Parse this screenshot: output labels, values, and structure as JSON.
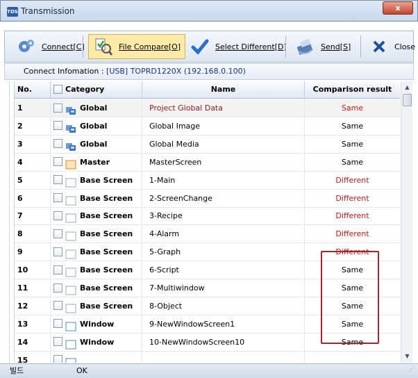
{
  "window": {
    "title": "Transmission",
    "app_icon_text": "TDS",
    "close_symbol": "x"
  },
  "toolbar": [
    {
      "label": "Connect",
      "key": "C"
    },
    {
      "label": "File Compare",
      "key": "O"
    },
    {
      "label": "Select Different",
      "key": "D"
    },
    {
      "label": "Send",
      "key": "S"
    },
    {
      "label": "Close"
    }
  ],
  "connect": {
    "label": "Connect Infomation :",
    "value": "[USB] TOPRD1220X (192.168.0.100)"
  },
  "columns": {
    "no": "No.",
    "category": "Category",
    "name": "Name",
    "result": "Comparison result"
  },
  "rows": [
    {
      "no": "1",
      "category": "Global",
      "icon": "global",
      "name": "Project Global Data",
      "result": "Same",
      "name_color": "#a01818"
    },
    {
      "no": "2",
      "category": "Global",
      "icon": "global",
      "name": "Global Image",
      "result": "Same"
    },
    {
      "no": "3",
      "category": "Global",
      "icon": "global",
      "name": "Global Media",
      "result": "Same"
    },
    {
      "no": "4",
      "category": "Master",
      "icon": "master",
      "name": "MasterScreen",
      "result": "Same"
    },
    {
      "no": "5",
      "category": "Base Screen",
      "icon": "screen",
      "name": "1-Main",
      "result": "Different"
    },
    {
      "no": "6",
      "category": "Base Screen",
      "icon": "screen",
      "name": "2-ScreenChange",
      "result": "Different"
    },
    {
      "no": "7",
      "category": "Base Screen",
      "icon": "screen",
      "name": "3-Recipe",
      "result": "Different"
    },
    {
      "no": "8",
      "category": "Base Screen",
      "icon": "screen",
      "name": "4-Alarm",
      "result": "Different"
    },
    {
      "no": "9",
      "category": "Base Screen",
      "icon": "screen",
      "name": "5-Graph",
      "result": "Different"
    },
    {
      "no": "10",
      "category": "Base Screen",
      "icon": "screen",
      "name": "6-Script",
      "result": "Same"
    },
    {
      "no": "11",
      "category": "Base Screen",
      "icon": "screen",
      "name": "7-Multiwindow",
      "result": "Same"
    },
    {
      "no": "12",
      "category": "Base Screen",
      "icon": "screen",
      "name": "8-Object",
      "result": "Same"
    },
    {
      "no": "13",
      "category": "Window",
      "icon": "window",
      "name": "9-NewWindowScreen1",
      "result": "Same"
    },
    {
      "no": "14",
      "category": "Window",
      "icon": "window",
      "name": "10-NewWindowScreen10",
      "result": "Same"
    },
    {
      "no": "15",
      "category": "",
      "icon": "window",
      "name": "",
      "result": ""
    }
  ],
  "colors": {
    "different": "#e01010",
    "same": "#000000",
    "highlight_box": "#b0222a"
  },
  "status": {
    "left": "빌드",
    "message": "OK"
  }
}
